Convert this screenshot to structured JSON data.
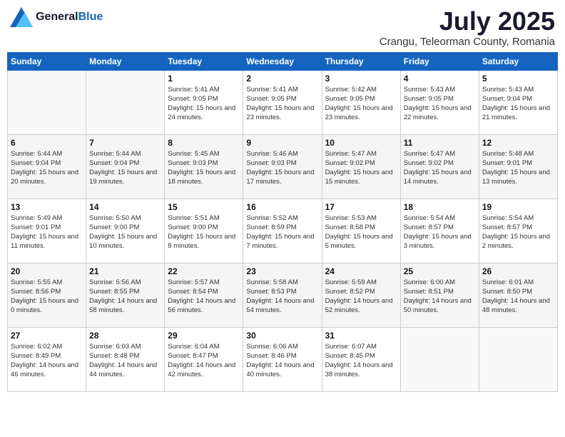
{
  "header": {
    "logo_general": "General",
    "logo_blue": "Blue",
    "month": "July 2025",
    "location": "Crangu, Teleorman County, Romania"
  },
  "weekdays": [
    "Sunday",
    "Monday",
    "Tuesday",
    "Wednesday",
    "Thursday",
    "Friday",
    "Saturday"
  ],
  "weeks": [
    [
      {
        "day": "",
        "sunrise": "",
        "sunset": "",
        "daylight": ""
      },
      {
        "day": "",
        "sunrise": "",
        "sunset": "",
        "daylight": ""
      },
      {
        "day": "1",
        "sunrise": "Sunrise: 5:41 AM",
        "sunset": "Sunset: 9:05 PM",
        "daylight": "Daylight: 15 hours and 24 minutes."
      },
      {
        "day": "2",
        "sunrise": "Sunrise: 5:41 AM",
        "sunset": "Sunset: 9:05 PM",
        "daylight": "Daylight: 15 hours and 23 minutes."
      },
      {
        "day": "3",
        "sunrise": "Sunrise: 5:42 AM",
        "sunset": "Sunset: 9:05 PM",
        "daylight": "Daylight: 15 hours and 23 minutes."
      },
      {
        "day": "4",
        "sunrise": "Sunrise: 5:43 AM",
        "sunset": "Sunset: 9:05 PM",
        "daylight": "Daylight: 15 hours and 22 minutes."
      },
      {
        "day": "5",
        "sunrise": "Sunrise: 5:43 AM",
        "sunset": "Sunset: 9:04 PM",
        "daylight": "Daylight: 15 hours and 21 minutes."
      }
    ],
    [
      {
        "day": "6",
        "sunrise": "Sunrise: 5:44 AM",
        "sunset": "Sunset: 9:04 PM",
        "daylight": "Daylight: 15 hours and 20 minutes."
      },
      {
        "day": "7",
        "sunrise": "Sunrise: 5:44 AM",
        "sunset": "Sunset: 9:04 PM",
        "daylight": "Daylight: 15 hours and 19 minutes."
      },
      {
        "day": "8",
        "sunrise": "Sunrise: 5:45 AM",
        "sunset": "Sunset: 9:03 PM",
        "daylight": "Daylight: 15 hours and 18 minutes."
      },
      {
        "day": "9",
        "sunrise": "Sunrise: 5:46 AM",
        "sunset": "Sunset: 9:03 PM",
        "daylight": "Daylight: 15 hours and 17 minutes."
      },
      {
        "day": "10",
        "sunrise": "Sunrise: 5:47 AM",
        "sunset": "Sunset: 9:02 PM",
        "daylight": "Daylight: 15 hours and 15 minutes."
      },
      {
        "day": "11",
        "sunrise": "Sunrise: 5:47 AM",
        "sunset": "Sunset: 9:02 PM",
        "daylight": "Daylight: 15 hours and 14 minutes."
      },
      {
        "day": "12",
        "sunrise": "Sunrise: 5:48 AM",
        "sunset": "Sunset: 9:01 PM",
        "daylight": "Daylight: 15 hours and 13 minutes."
      }
    ],
    [
      {
        "day": "13",
        "sunrise": "Sunrise: 5:49 AM",
        "sunset": "Sunset: 9:01 PM",
        "daylight": "Daylight: 15 hours and 11 minutes."
      },
      {
        "day": "14",
        "sunrise": "Sunrise: 5:50 AM",
        "sunset": "Sunset: 9:00 PM",
        "daylight": "Daylight: 15 hours and 10 minutes."
      },
      {
        "day": "15",
        "sunrise": "Sunrise: 5:51 AM",
        "sunset": "Sunset: 9:00 PM",
        "daylight": "Daylight: 15 hours and 8 minutes."
      },
      {
        "day": "16",
        "sunrise": "Sunrise: 5:52 AM",
        "sunset": "Sunset: 8:59 PM",
        "daylight": "Daylight: 15 hours and 7 minutes."
      },
      {
        "day": "17",
        "sunrise": "Sunrise: 5:53 AM",
        "sunset": "Sunset: 8:58 PM",
        "daylight": "Daylight: 15 hours and 5 minutes."
      },
      {
        "day": "18",
        "sunrise": "Sunrise: 5:54 AM",
        "sunset": "Sunset: 8:57 PM",
        "daylight": "Daylight: 15 hours and 3 minutes."
      },
      {
        "day": "19",
        "sunrise": "Sunrise: 5:54 AM",
        "sunset": "Sunset: 8:57 PM",
        "daylight": "Daylight: 15 hours and 2 minutes."
      }
    ],
    [
      {
        "day": "20",
        "sunrise": "Sunrise: 5:55 AM",
        "sunset": "Sunset: 8:56 PM",
        "daylight": "Daylight: 15 hours and 0 minutes."
      },
      {
        "day": "21",
        "sunrise": "Sunrise: 5:56 AM",
        "sunset": "Sunset: 8:55 PM",
        "daylight": "Daylight: 14 hours and 58 minutes."
      },
      {
        "day": "22",
        "sunrise": "Sunrise: 5:57 AM",
        "sunset": "Sunset: 8:54 PM",
        "daylight": "Daylight: 14 hours and 56 minutes."
      },
      {
        "day": "23",
        "sunrise": "Sunrise: 5:58 AM",
        "sunset": "Sunset: 8:53 PM",
        "daylight": "Daylight: 14 hours and 54 minutes."
      },
      {
        "day": "24",
        "sunrise": "Sunrise: 5:59 AM",
        "sunset": "Sunset: 8:52 PM",
        "daylight": "Daylight: 14 hours and 52 minutes."
      },
      {
        "day": "25",
        "sunrise": "Sunrise: 6:00 AM",
        "sunset": "Sunset: 8:51 PM",
        "daylight": "Daylight: 14 hours and 50 minutes."
      },
      {
        "day": "26",
        "sunrise": "Sunrise: 6:01 AM",
        "sunset": "Sunset: 8:50 PM",
        "daylight": "Daylight: 14 hours and 48 minutes."
      }
    ],
    [
      {
        "day": "27",
        "sunrise": "Sunrise: 6:02 AM",
        "sunset": "Sunset: 8:49 PM",
        "daylight": "Daylight: 14 hours and 46 minutes."
      },
      {
        "day": "28",
        "sunrise": "Sunrise: 6:03 AM",
        "sunset": "Sunset: 8:48 PM",
        "daylight": "Daylight: 14 hours and 44 minutes."
      },
      {
        "day": "29",
        "sunrise": "Sunrise: 6:04 AM",
        "sunset": "Sunset: 8:47 PM",
        "daylight": "Daylight: 14 hours and 42 minutes."
      },
      {
        "day": "30",
        "sunrise": "Sunrise: 6:06 AM",
        "sunset": "Sunset: 8:46 PM",
        "daylight": "Daylight: 14 hours and 40 minutes."
      },
      {
        "day": "31",
        "sunrise": "Sunrise: 6:07 AM",
        "sunset": "Sunset: 8:45 PM",
        "daylight": "Daylight: 14 hours and 38 minutes."
      },
      {
        "day": "",
        "sunrise": "",
        "sunset": "",
        "daylight": ""
      },
      {
        "day": "",
        "sunrise": "",
        "sunset": "",
        "daylight": ""
      }
    ]
  ]
}
